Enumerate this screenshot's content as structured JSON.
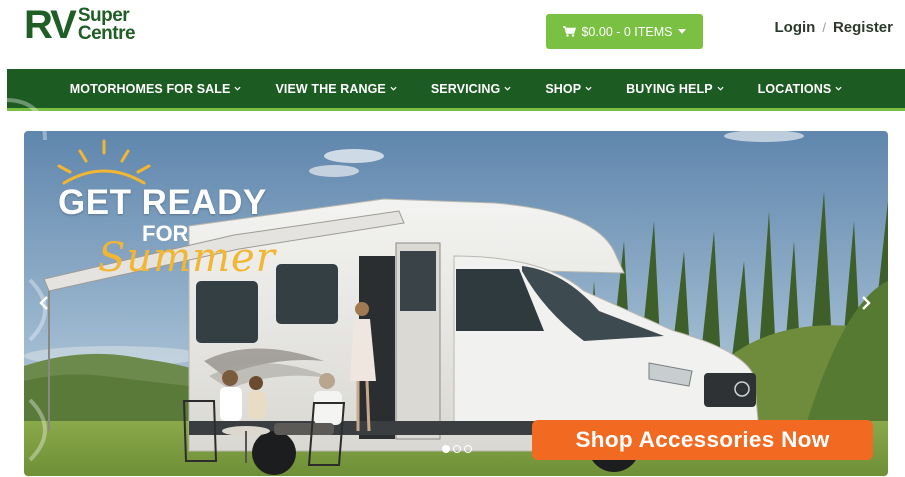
{
  "logo": {
    "main": "RV",
    "line1": "Super",
    "line2": "Centre"
  },
  "cart": {
    "label": "$0.00 - 0 ITEMS",
    "icon": "shopping-cart-icon",
    "caret": "caret-down-icon"
  },
  "auth": {
    "login": "Login",
    "separator": "/",
    "register": "Register"
  },
  "nav": {
    "items": [
      {
        "label": "MOTORHOMES FOR SALE"
      },
      {
        "label": "VIEW THE RANGE"
      },
      {
        "label": "SERVICING"
      },
      {
        "label": "SHOP"
      },
      {
        "label": "BUYING HELP"
      },
      {
        "label": "LOCATIONS"
      }
    ]
  },
  "hero": {
    "headline_line1": "GET READY",
    "headline_line2": "FOR",
    "headline_line3": "Summer",
    "cta": "Shop Accessories Now",
    "slides_total": 3,
    "active_slide": 1
  },
  "colors": {
    "brand_green": "#1c5c23",
    "accent_green": "#7ac143",
    "cta_orange": "#f26a21",
    "summer_yellow": "#f2b632"
  }
}
